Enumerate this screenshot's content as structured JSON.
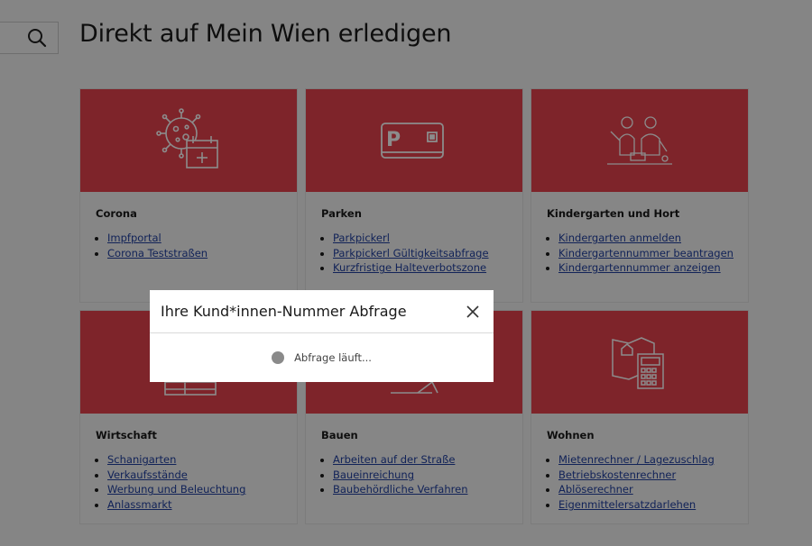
{
  "page": {
    "title": "Direkt auf Mein Wien erledigen"
  },
  "search": {
    "icon": "search-icon"
  },
  "accent": "#e5434e",
  "cards": [
    {
      "title": "Corona",
      "icon": "virus-calendar-icon",
      "links": [
        "Impfportal",
        "Corona Teststraßen"
      ]
    },
    {
      "title": "Parken",
      "icon": "parking-card-icon",
      "links": [
        "Parkpickerl",
        "Parkpickerl Gültigkeitsabfrage",
        "Kurzfristige Halteverbotszone"
      ]
    },
    {
      "title": "Kindergarten und Hort",
      "icon": "children-icon",
      "links": [
        "Kindergarten anmelden",
        "Kindergartennummer beantragen",
        "Kindergartennummer anzeigen"
      ]
    },
    {
      "title": "Wirtschaft",
      "icon": "shop-icon",
      "links": [
        "Schanigarten",
        "Verkaufsstände",
        "Werbung und Beleuchtung",
        "Anlassmarkt"
      ]
    },
    {
      "title": "Bauen",
      "icon": "construction-icon",
      "links": [
        "Arbeiten auf der Straße",
        "Baueinreichung",
        "Baubehördliche Verfahren"
      ]
    },
    {
      "title": "Wohnen",
      "icon": "map-calculator-icon",
      "links": [
        "Mietenrechner / Lagezuschlag",
        "Betriebskostenrechner",
        "Ablöserechner",
        "Eigenmittelersatzdarlehen"
      ]
    }
  ],
  "modal": {
    "title": "Ihre Kund*innen-Nummer Abfrage",
    "loading_text": "Abfrage läuft...",
    "close_icon": "close-icon"
  }
}
